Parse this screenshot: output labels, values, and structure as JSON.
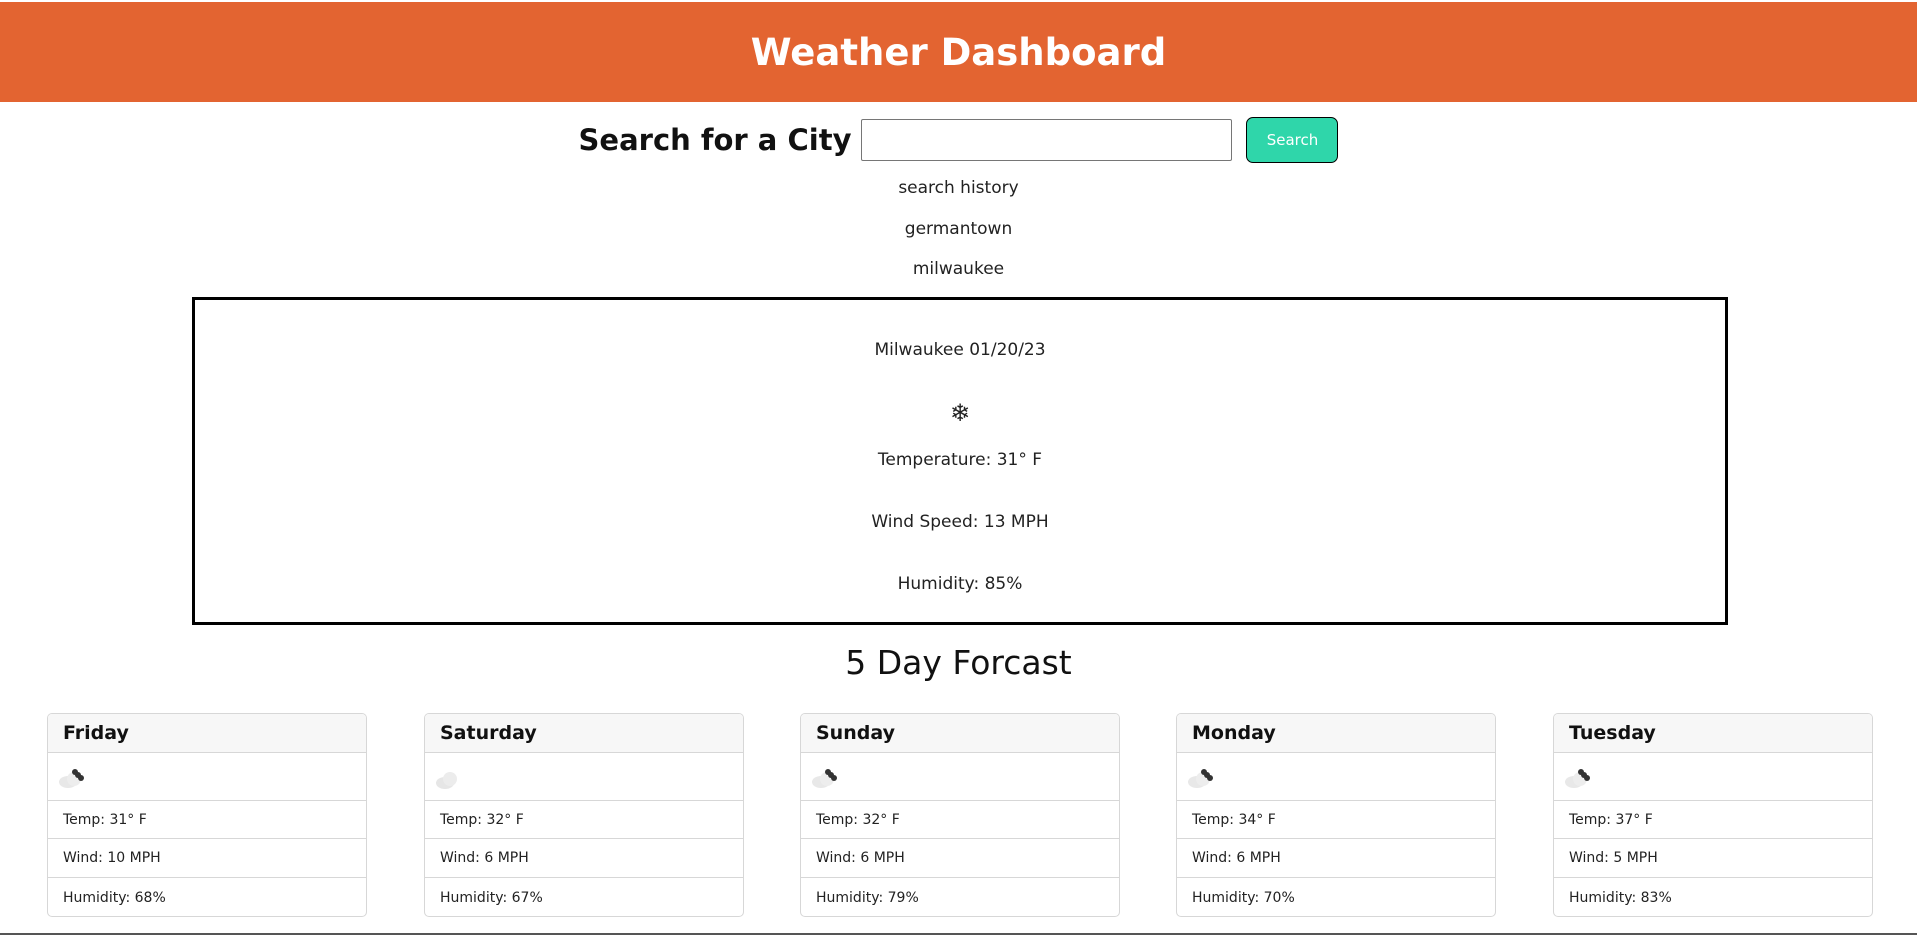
{
  "header": {
    "title": "Weather Dashboard"
  },
  "search": {
    "label": "Search for a City",
    "value": "",
    "placeholder": "",
    "button_label": "Search"
  },
  "history": {
    "title": "search history",
    "items": [
      "germantown",
      "milwaukee"
    ]
  },
  "current": {
    "city_date": "Milwaukee 01/20/23",
    "icon": "❄",
    "temperature": "Temperature: 31° F",
    "wind": "Wind Speed: 13 MPH",
    "humidity": "Humidity: 85%"
  },
  "forecast": {
    "title": "5 Day Forcast",
    "days": [
      {
        "day": "Friday",
        "icon": "snow-cloud-icon",
        "temp": "Temp: 31° F",
        "wind": "Wind: 10 MPH",
        "humidity": "Humidity: 68%"
      },
      {
        "day": "Saturday",
        "icon": "cloud-icon",
        "temp": "Temp: 32° F",
        "wind": "Wind: 6 MPH",
        "humidity": "Humidity: 67%"
      },
      {
        "day": "Sunday",
        "icon": "snow-cloud-icon",
        "temp": "Temp: 32° F",
        "wind": "Wind: 6 MPH",
        "humidity": "Humidity: 79%"
      },
      {
        "day": "Monday",
        "icon": "snow-cloud-icon",
        "temp": "Temp: 34° F",
        "wind": "Wind: 6 MPH",
        "humidity": "Humidity: 70%"
      },
      {
        "day": "Tuesday",
        "icon": "snow-cloud-icon",
        "temp": "Temp: 37° F",
        "wind": "Wind: 5 MPH",
        "humidity": "Humidity: 83%"
      }
    ]
  },
  "colors": {
    "header": "#e36431",
    "search_button": "#2fd6aa"
  }
}
